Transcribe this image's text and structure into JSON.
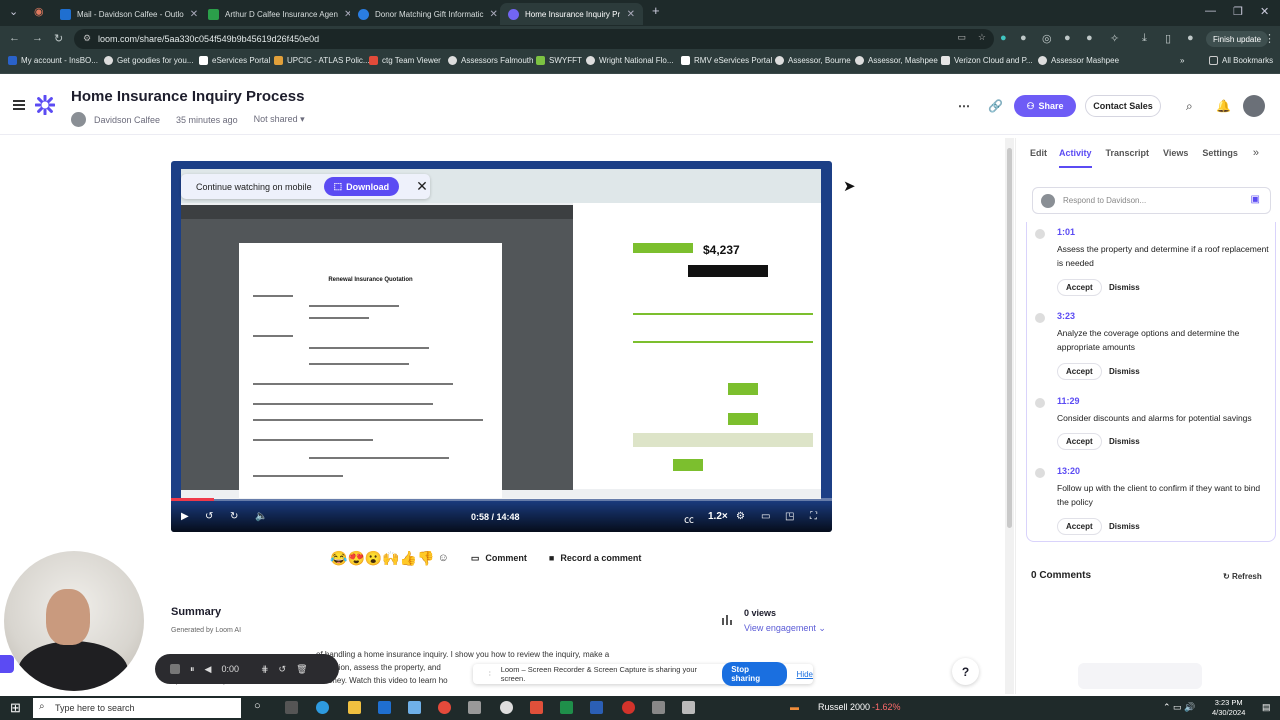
{
  "browser": {
    "tabs": [
      {
        "label": "Mail - Davidson Calfee - Outlo",
        "color": "#1f6fd0"
      },
      {
        "label": "Arthur D Calfee Insurance Agen",
        "color": "#2b9f4a"
      },
      {
        "label": "Donor Matching Gift Informatic",
        "color": "#2a7de1"
      },
      {
        "label": "Home Insurance Inquiry Pr",
        "color": "#7265f2"
      }
    ],
    "url": "loom.com/share/5aa330c054f549b9b45619d26f450e0d",
    "finish_update": "Finish update",
    "bookmarks": [
      "My account - InsBO...",
      "Get goodies for you...",
      "eServices Portal",
      "UPCIC - ATLAS Polic...",
      "ctg Team Viewer",
      "Assessors Falmouth",
      "SWYFFT",
      "Wright National Flo...",
      "RMV eServices Portal",
      "Assessor, Bourne",
      "Assessor, Mashpee",
      "Verizon Cloud and P...",
      "Assessor Mashpee"
    ],
    "all_bookmarks": "All Bookmarks"
  },
  "header": {
    "title": "Home Insurance Inquiry Process",
    "author": "Davidson Calfee",
    "time_ago": "35 minutes ago",
    "sharing_status": "Not shared",
    "share_label": "Share",
    "contact_label": "Contact Sales"
  },
  "video": {
    "mobile_prompt": "Continue watching on mobile",
    "download_label": "Download",
    "current_time": "0:58",
    "duration": "14:48",
    "speed": "1.2×",
    "progress_fraction": 0.065,
    "pdf_title": "Renewal Insurance Quotation",
    "price": "$4,237"
  },
  "reactions": {
    "emojis": [
      "😂",
      "😍",
      "😮",
      "🙌",
      "👍",
      "👎"
    ],
    "comment_label": "Comment",
    "record_label": "Record a comment"
  },
  "summary": {
    "title": "Summary",
    "generated_by": "Generated by Loom AI",
    "views": "0 views",
    "engagement": "View engagement",
    "text_line1": "of handling a home insurance inquiry. I show you how to review the inquiry, make a",
    "text_line2": "formation, assess the property, and",
    "text_line3": "options and explain how to save the client money. Watch this video to learn ho"
  },
  "right_panel": {
    "tabs": [
      "Edit",
      "Activity",
      "Transcript",
      "Views",
      "Settings"
    ],
    "respond_placeholder": "Respond to Davidson...",
    "tasks": [
      {
        "time": "1:01",
        "text": "Assess the property and determine if a roof replacement is needed"
      },
      {
        "time": "3:23",
        "text": "Analyze the coverage options and determine the appropriate amounts"
      },
      {
        "time": "11:29",
        "text": "Consider discounts and alarms for potential savings"
      },
      {
        "time": "13:20",
        "text": "Follow up with the client to confirm if they want to bind the policy"
      }
    ],
    "accept_label": "Accept",
    "dismiss_label": "Dismiss",
    "comments_count": "0 Comments",
    "refresh_label": "Refresh"
  },
  "recorder": {
    "time": "0:00",
    "sharing_text": "Loom – Screen Recorder & Screen Capture is sharing your screen.",
    "stop_sharing": "Stop sharing",
    "hide": "Hide"
  },
  "taskbar": {
    "search_placeholder": "Type here to search",
    "ticker": "Russell 2000",
    "ticker_change": "-1.62%",
    "time": "3:23 PM",
    "date": "4/30/2024"
  }
}
